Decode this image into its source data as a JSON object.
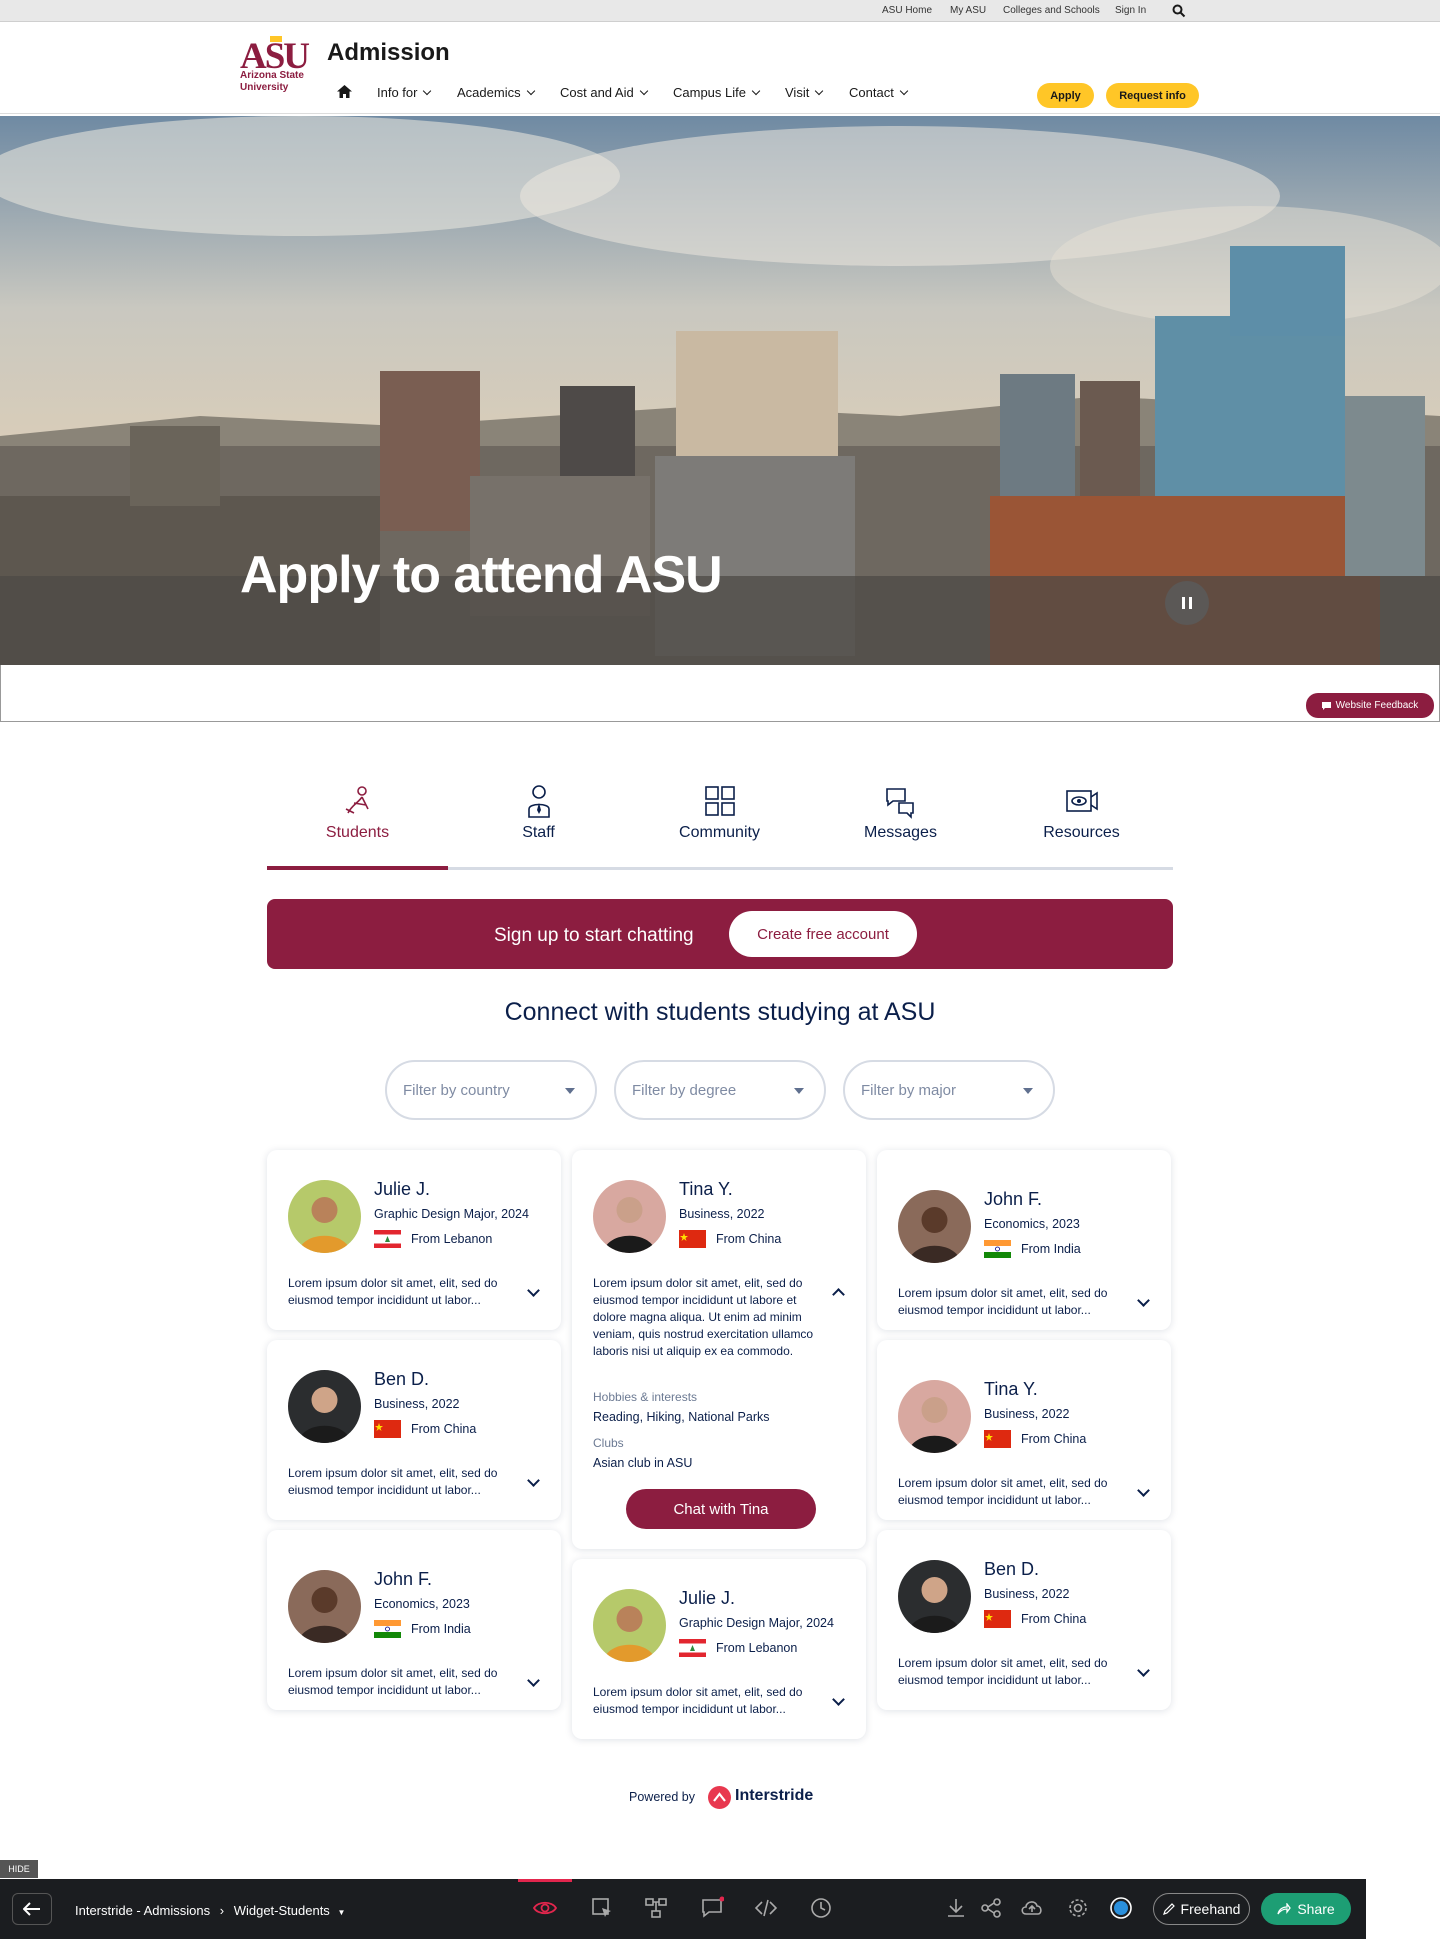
{
  "topbar": {
    "links": [
      "ASU Home",
      "My ASU",
      "Colleges and Schools",
      "Sign In"
    ]
  },
  "header": {
    "logo_mark": "ASU",
    "logo_sub": "Arizona State University",
    "title": "Admission",
    "nav": [
      "Info for",
      "Academics",
      "Cost and Aid",
      "Campus Life",
      "Visit",
      "Contact"
    ],
    "apply_label": "Apply",
    "request_label": "Request info"
  },
  "hero": {
    "title": "Apply to attend ASU"
  },
  "feedback_label": "Website Feedback",
  "widget": {
    "tabs": [
      "Students",
      "Staff",
      "Community",
      "Messages",
      "Resources"
    ],
    "active_tab": "Students",
    "signup_text": "Sign up to start chatting",
    "signup_button": "Create free account",
    "heading": "Connect with students studying at ASU",
    "filters": [
      "Filter by country",
      "Filter by degree",
      "Filter by major"
    ],
    "bio": "Lorem ipsum dolor sit amet, elit, sed do eiusmod tempor incididunt ut labor...",
    "cards": [
      {
        "name": "Julie J.",
        "major": "Graphic Design Major, 2024",
        "from": "From Lebanon",
        "flag": "lebanon"
      },
      {
        "name": "Tina Y.",
        "major": "Business, 2022",
        "from": "From China",
        "flag": "china"
      },
      {
        "name": "John F.",
        "major": "Economics, 2023",
        "from": "From India",
        "flag": "india"
      },
      {
        "name": "Ben D.",
        "major": "Business, 2022",
        "from": "From China",
        "flag": "china"
      },
      {
        "name": "Tina Y.",
        "major": "Business, 2022",
        "from": "From China",
        "flag": "china"
      },
      {
        "name": "John F.",
        "major": "Economics, 2023",
        "from": "From India",
        "flag": "india"
      },
      {
        "name": "Julie J.",
        "major": "Graphic Design Major, 2024",
        "from": "From Lebanon",
        "flag": "lebanon"
      },
      {
        "name": "Ben D.",
        "major": "Business, 2022",
        "from": "From China",
        "flag": "china"
      }
    ],
    "expanded": {
      "bio": "Lorem ipsum dolor sit amet, elit, sed do eiusmod tempor incididunt ut labore et dolore magna aliqua. Ut enim ad minim veniam, quis nostrud exercitation ullamco laboris nisi ut aliquip ex ea commodo.",
      "hobbies_label": "Hobbies & interests",
      "hobbies": "Reading, Hiking, National Parks",
      "clubs_label": "Clubs",
      "clubs": "Asian club in ASU",
      "chat_button": "Chat with Tina"
    },
    "powered_by": "Powered by",
    "powered_name": "Interstride"
  },
  "toolbar": {
    "hide": "HIDE",
    "crumb_project": "Interstride - Admissions",
    "crumb_separator": "›",
    "crumb_page": "Widget-Students",
    "freehand": "Freehand",
    "share": "Share"
  },
  "colors": {
    "asu_maroon": "#8c1d40",
    "asu_gold": "#ffc627",
    "navy": "#0b1f4a",
    "share_green": "#1d9e74"
  }
}
